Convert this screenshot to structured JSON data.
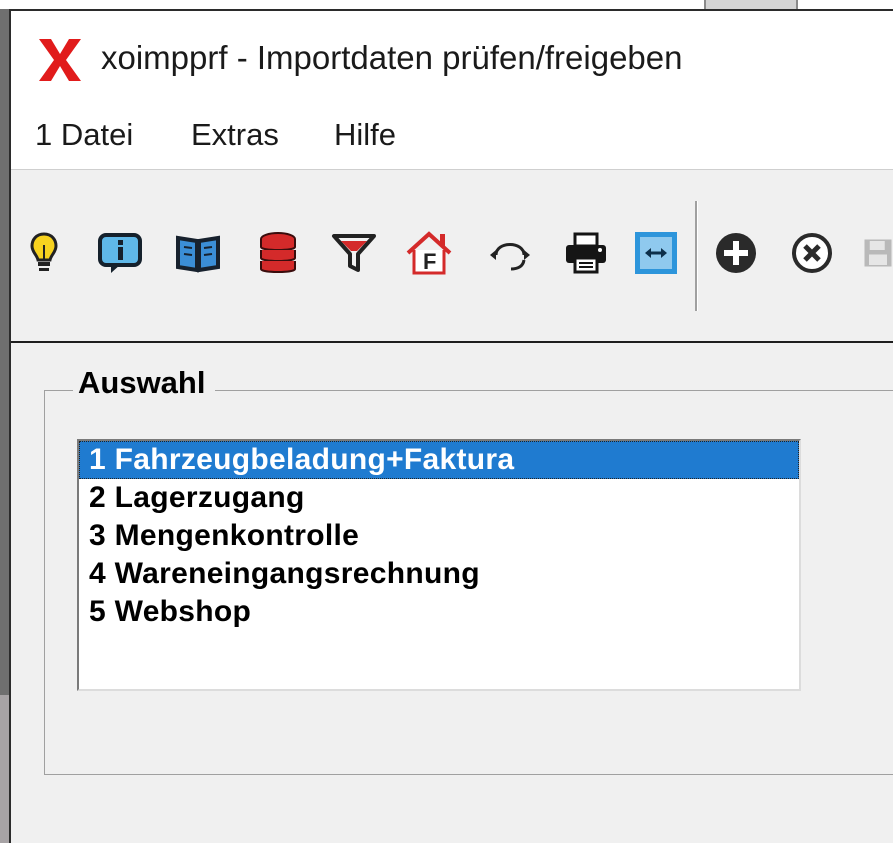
{
  "window": {
    "title": "xoimpprf - Importdaten prüfen/freigeben"
  },
  "menu": {
    "items": [
      {
        "label": "1 Datei"
      },
      {
        "label": "Extras"
      },
      {
        "label": "Hilfe"
      }
    ]
  },
  "toolbar": {
    "buttons": [
      {
        "icon": "lightbulb-icon"
      },
      {
        "icon": "info-icon"
      },
      {
        "icon": "book-icon"
      },
      {
        "icon": "database-icon"
      },
      {
        "icon": "filter-icon"
      },
      {
        "icon": "home-icon"
      },
      {
        "icon": "headset-icon"
      },
      {
        "icon": "printer-icon"
      },
      {
        "icon": "transfer-icon"
      },
      {
        "icon": "add-icon"
      },
      {
        "icon": "delete-icon"
      },
      {
        "icon": "save-icon"
      }
    ]
  },
  "auswahl": {
    "label": "Auswahl",
    "items": [
      {
        "label": "1 Fahrzeugbeladung+Faktura",
        "selected": true
      },
      {
        "label": "2 Lagerzugang"
      },
      {
        "label": "3 Mengenkontrolle"
      },
      {
        "label": "4 Wareneingangsrechnung"
      },
      {
        "label": "5 Webshop"
      }
    ]
  },
  "colors": {
    "selection": "#1f7bd0",
    "app_icon": "#e11b1b",
    "database": "#d42a2a",
    "transfer": "#2d95db"
  }
}
